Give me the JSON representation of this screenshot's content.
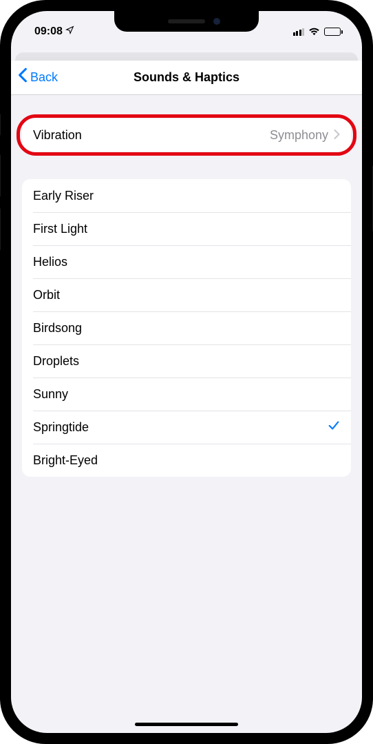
{
  "status": {
    "time": "09:08"
  },
  "nav": {
    "back_label": "Back",
    "title": "Sounds & Haptics"
  },
  "vibration": {
    "label": "Vibration",
    "value": "Symphony"
  },
  "sounds": [
    {
      "name": "Early Riser",
      "selected": false
    },
    {
      "name": "First Light",
      "selected": false
    },
    {
      "name": "Helios",
      "selected": false
    },
    {
      "name": "Orbit",
      "selected": false
    },
    {
      "name": "Birdsong",
      "selected": false
    },
    {
      "name": "Droplets",
      "selected": false
    },
    {
      "name": "Sunny",
      "selected": false
    },
    {
      "name": "Springtide",
      "selected": true
    },
    {
      "name": "Bright-Eyed",
      "selected": false
    }
  ]
}
